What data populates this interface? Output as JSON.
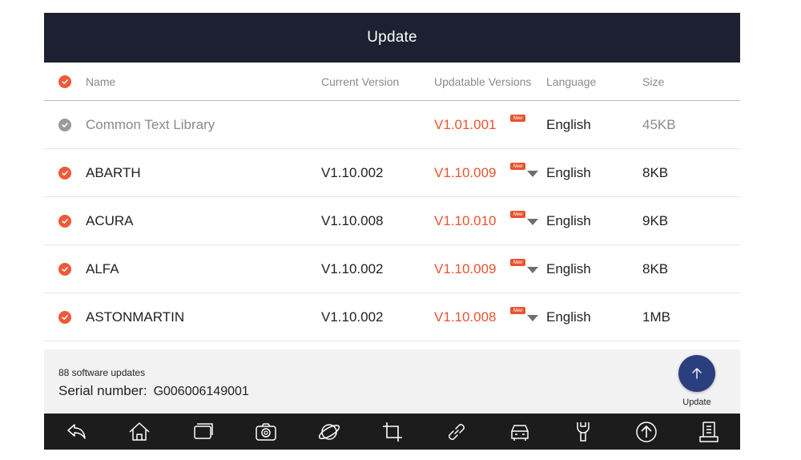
{
  "title": "Update",
  "columns": {
    "name": "Name",
    "current": "Current Version",
    "updatable": "Updatable Versions",
    "language": "Language",
    "size": "Size"
  },
  "rows": [
    {
      "name": "Common Text Library",
      "current": "",
      "updatable": "V1.01.001",
      "language": "English",
      "size": "45KB",
      "selected": false,
      "new_badge": "New"
    },
    {
      "name": "ABARTH",
      "current": "V1.10.002",
      "updatable": "V1.10.009",
      "language": "English",
      "size": "8KB",
      "selected": true,
      "new_badge": "New"
    },
    {
      "name": "ACURA",
      "current": "V1.10.008",
      "updatable": "V1.10.010",
      "language": "English",
      "size": "9KB",
      "selected": true,
      "new_badge": "New"
    },
    {
      "name": "ALFA",
      "current": "V1.10.002",
      "updatable": "V1.10.009",
      "language": "English",
      "size": "8KB",
      "selected": true,
      "new_badge": "New"
    },
    {
      "name": "ASTONMARTIN",
      "current": "V1.10.002",
      "updatable": "V1.10.008",
      "language": "English",
      "size": "1MB",
      "selected": true,
      "new_badge": "New"
    }
  ],
  "footer": {
    "count_text": "88 software updates",
    "serial_label": "Serial number:",
    "serial_value": "G006006149001",
    "update_label": "Update"
  },
  "colors": {
    "accent": "#ef5a36",
    "titlebar": "#1c2030",
    "update_button": "#2a3f7d"
  },
  "navbar_icons": [
    "back-icon",
    "home-icon",
    "recent-apps-icon",
    "camera-icon",
    "browser-icon",
    "crop-icon",
    "link-icon",
    "car-icon",
    "wrench-icon",
    "upload-icon",
    "report-icon"
  ]
}
